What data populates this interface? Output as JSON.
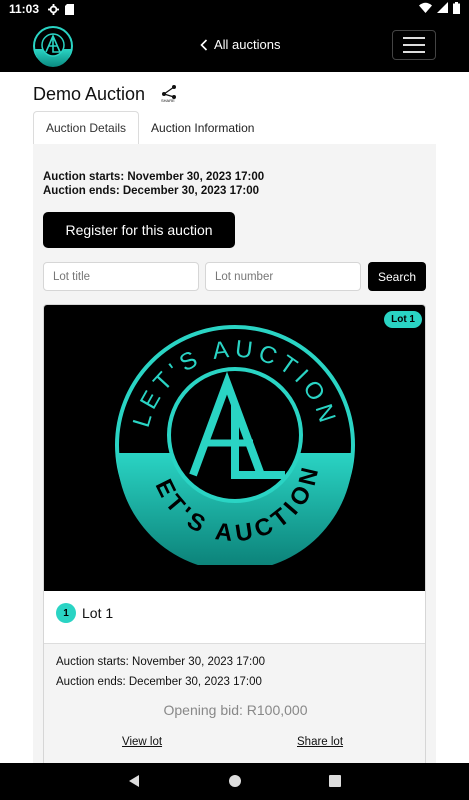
{
  "status_bar": {
    "time": "11:03"
  },
  "navbar": {
    "back_label": "All auctions"
  },
  "page": {
    "title": "Demo Auction",
    "share_label": "SHARE"
  },
  "tabs": [
    {
      "label": "Auction Details",
      "active": true
    },
    {
      "label": "Auction Information",
      "active": false
    }
  ],
  "auction": {
    "starts": "Auction starts: November 30, 2023 17:00",
    "ends": "Auction ends: December 30, 2023 17:00"
  },
  "register_button": "Register for this auction",
  "search": {
    "lot_title_placeholder": "Lot title",
    "lot_number_placeholder": "Lot number",
    "button": "Search"
  },
  "lot": {
    "badge": "Lot 1",
    "number": "1",
    "title": "Lot 1",
    "logo_text_top": "LET'S AUCTION",
    "logo_text_bottom": "LET'S AUCTION",
    "starts": "Auction starts: November 30, 2023 17:00",
    "ends": "Auction ends: December 30, 2023 17:00",
    "opening_bid": "Opening bid: R100,000",
    "view_link": "View lot",
    "share_link": "Share lot"
  },
  "colors": {
    "accent": "#2ad4c4",
    "dark": "#000000"
  }
}
